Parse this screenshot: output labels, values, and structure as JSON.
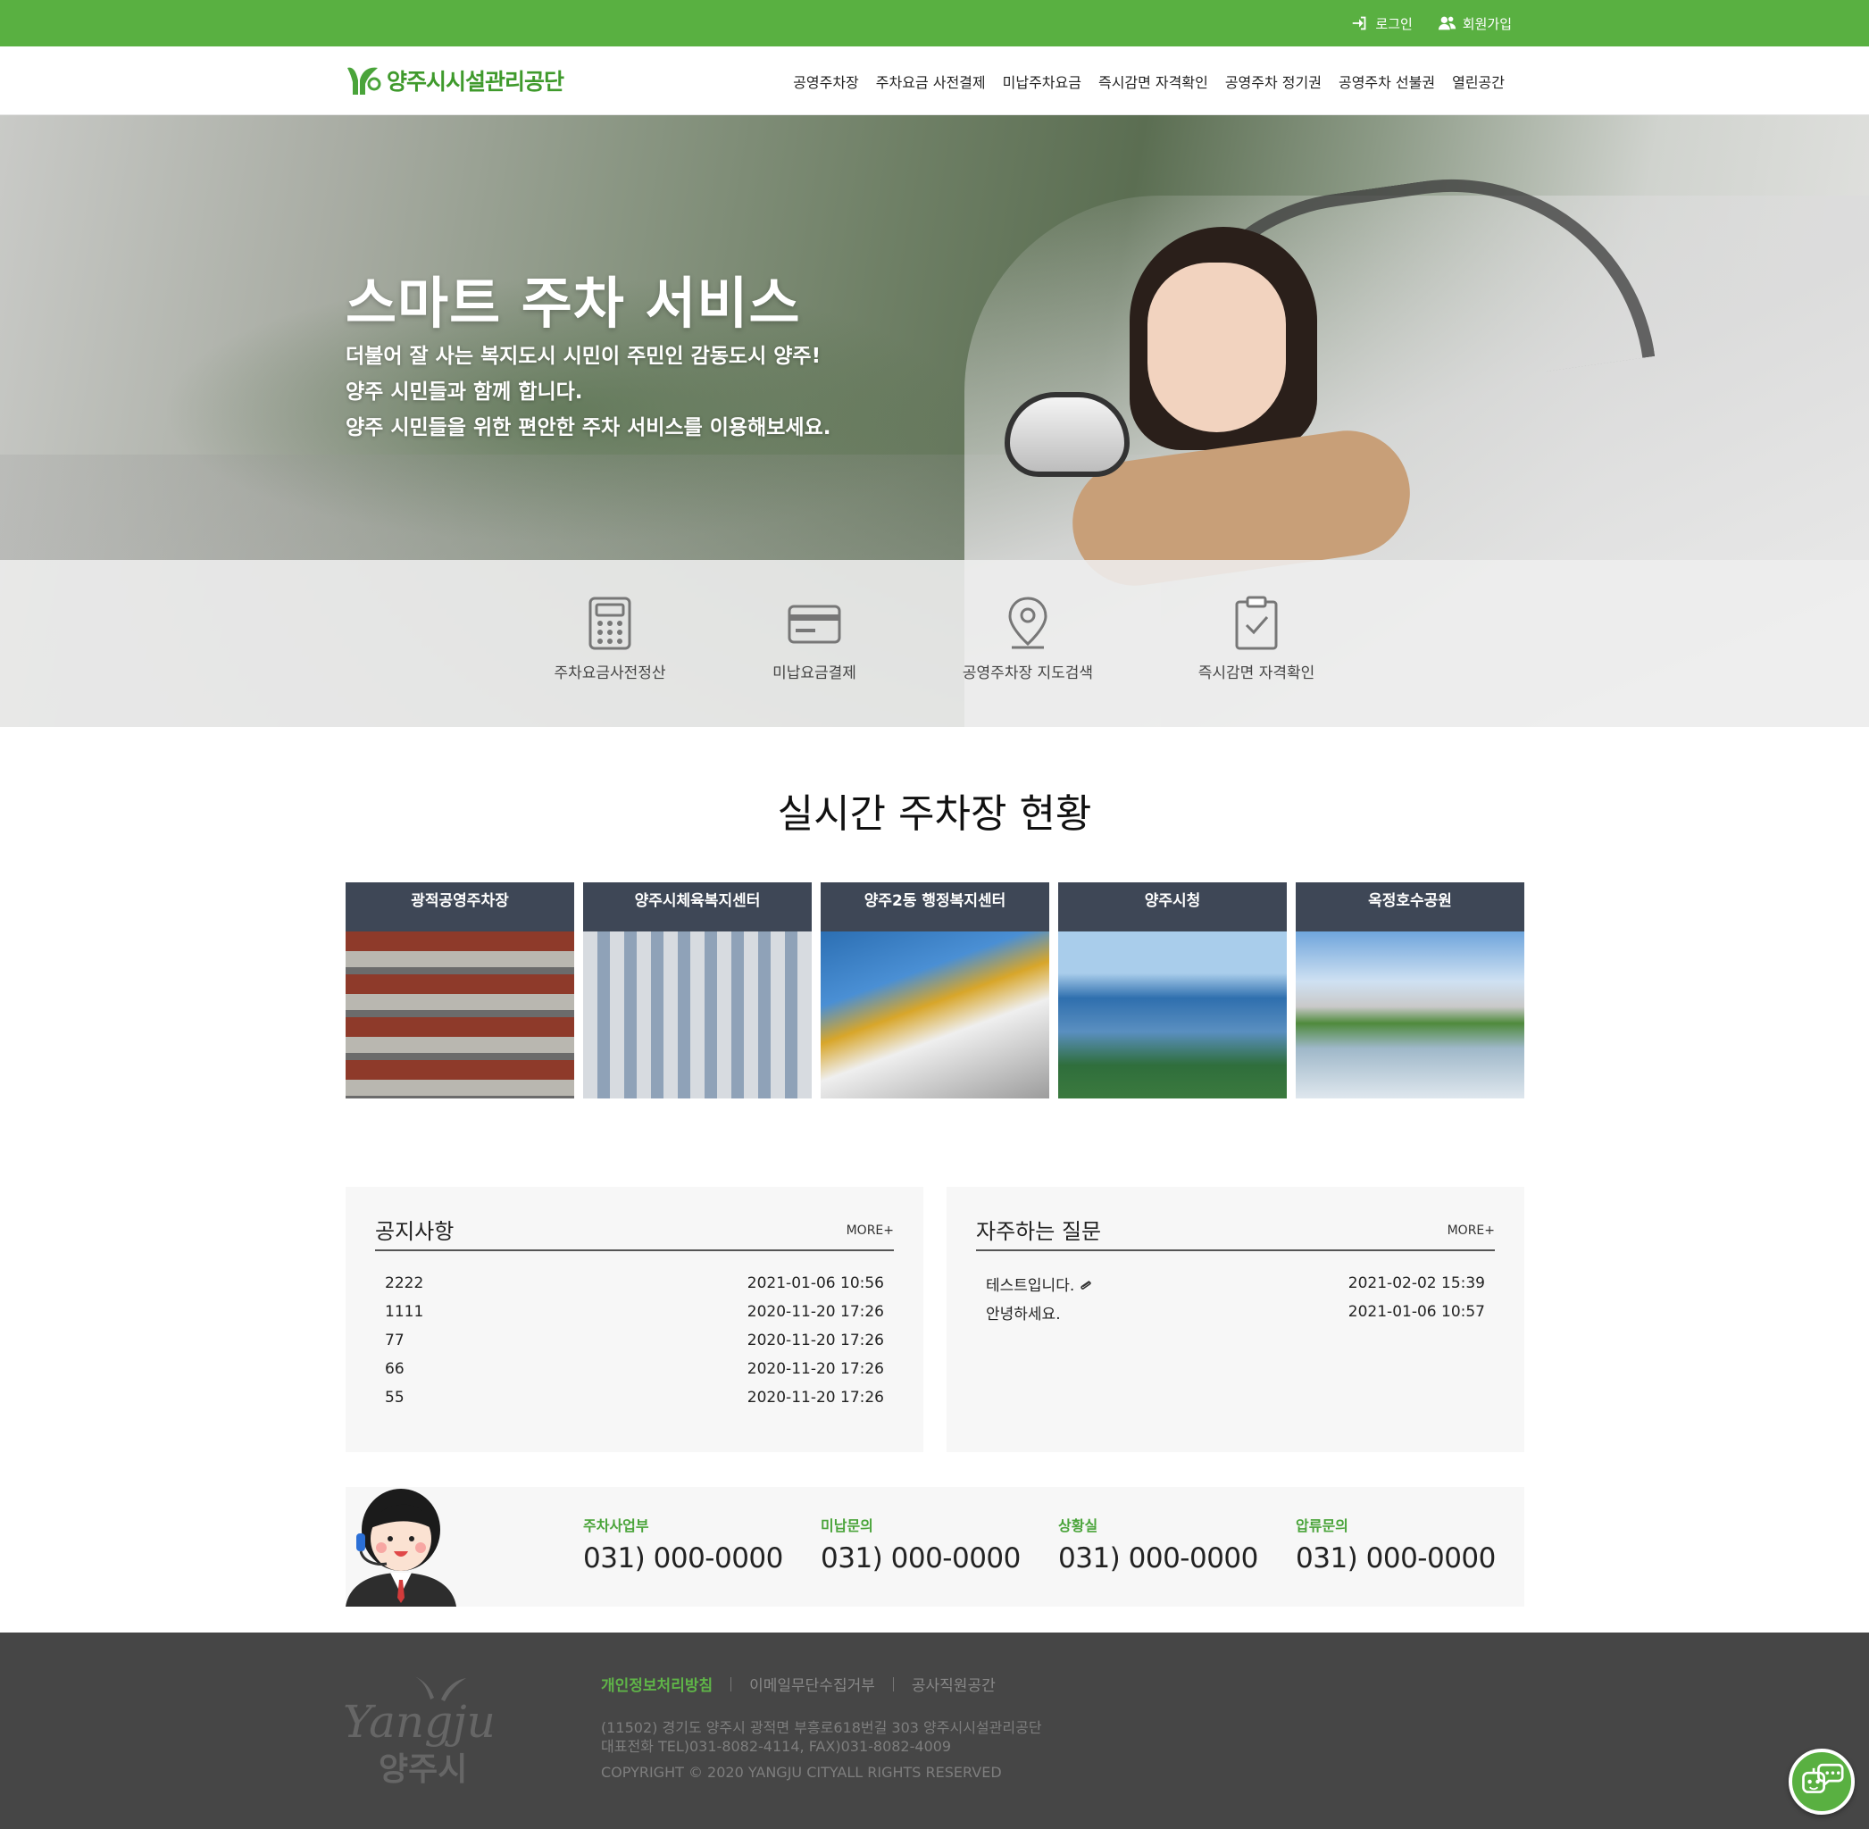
{
  "topbar": {
    "login": "로그인",
    "signup": "회원가입"
  },
  "header": {
    "logo_text": "양주시시설관리공단",
    "nav": [
      "공영주차장",
      "주차요금 사전결제",
      "미납주차요금",
      "즉시감면 자격확인",
      "공영주차 정기권",
      "공영주차 선불권",
      "열린공간"
    ]
  },
  "hero": {
    "title": "스마트 주차 서비스",
    "line1": "더불어 잘 사는 복지도시 시민이 주민인 감동도시 양주!",
    "line2": "양주 시민들과 함께 합니다.",
    "line3": "양주 시민들을 위한 편안한 주차 서비스를 이용해보세요."
  },
  "quick": [
    {
      "label": "주차요금사전정산",
      "icon": "calculator-icon"
    },
    {
      "label": "미납요금결제",
      "icon": "credit-card-icon"
    },
    {
      "label": "공영주차장 지도검색",
      "icon": "map-pin-icon"
    },
    {
      "label": "즉시감면 자격확인",
      "icon": "clipboard-check-icon"
    }
  ],
  "parking": {
    "title": "실시간 주차장 현황",
    "lots": [
      "광적공영주차장",
      "양주시체육복지센터",
      "양주2동 행정복지센터",
      "양주시청",
      "옥정호수공원"
    ]
  },
  "notice": {
    "title": "공지사항",
    "more": "MORE+",
    "rows": [
      {
        "title": "2222",
        "date": "2021-01-06 10:56"
      },
      {
        "title": "1111",
        "date": "2020-11-20 17:26"
      },
      {
        "title": "77",
        "date": "2020-11-20 17:26"
      },
      {
        "title": "66",
        "date": "2020-11-20 17:26"
      },
      {
        "title": "55",
        "date": "2020-11-20 17:26"
      }
    ]
  },
  "faq": {
    "title": "자주하는 질문",
    "more": "MORE+",
    "rows": [
      {
        "title": "테스트입니다.",
        "date": "2021-02-02 15:39",
        "attachment": true
      },
      {
        "title": "안녕하세요.",
        "date": "2021-01-06 10:57"
      }
    ]
  },
  "contact": [
    {
      "label": "주차사업부",
      "phone": "031) 000-0000"
    },
    {
      "label": "미납문의",
      "phone": "031) 000-0000"
    },
    {
      "label": "상황실",
      "phone": "031) 000-0000"
    },
    {
      "label": "압류문의",
      "phone": "031) 000-0000"
    }
  ],
  "footer": {
    "logo_en": "Yangju",
    "logo_ko": "양주시",
    "links": [
      "개인정보처리방침",
      "이메일무단수집거부",
      "공사직원공간"
    ],
    "address": "(11502) 경기도 양주시 광적면 부흥로618번길 303 양주시시설관리공단",
    "phone": "대표전화 TEL)031-8082-4114, FAX)031-8082-4009",
    "copyright": "COPYRIGHT © 2020 YANGJU CITYALL RIGHTS RESERVED"
  },
  "colors": {
    "brand_green": "#59b041",
    "caption_bg": "#3e4756",
    "footer_bg": "#464646"
  }
}
